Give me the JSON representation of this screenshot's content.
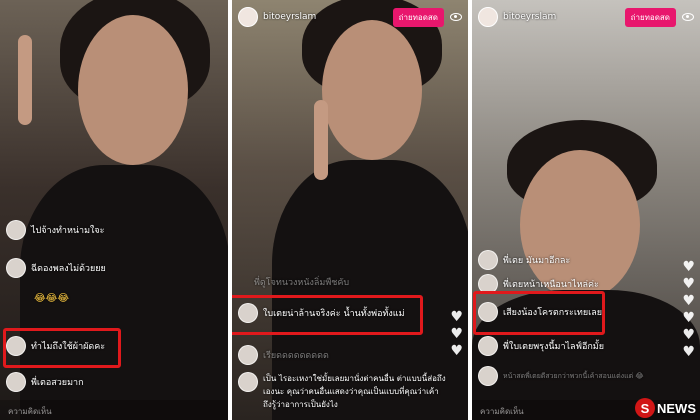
{
  "panels": [
    {
      "username": "",
      "comments": [
        {
          "text": "ไปจ้างทำหน่ามใจะ",
          "dim": false
        },
        {
          "text": "ฉีดองพลงไม่ด้วยยย",
          "dim": false
        },
        {
          "text": "😂😂😂",
          "dim": false
        },
        {
          "text": "ทำไมถึงใช้ผ้าผัดคะ",
          "dim": false,
          "highlighted": true
        },
        {
          "text": "พี่เตอสวยมาก",
          "dim": false
        }
      ],
      "comment_placeholder": "ความคิดเห็น"
    },
    {
      "username": "bitoeyrslam",
      "live_label": "ถ่ายทอดสด",
      "comments": [
        {
          "text": "พี่ดูโจทนวงหนังลิ่มพืชคับ",
          "dim": true
        },
        {
          "text": "ใบเตยน่าล้านจริงค่ะ น้ำนทั้งพ่อทั้งแม่",
          "dim": false,
          "highlighted": true
        },
        {
          "text": "เรียดดดดดดดดด",
          "dim": true
        },
        {
          "text": "เป็น ไรอะเหงาใช่มั้ยเลยมานั่งต่าคนอื่น ต่าแบบนี้ส่อถึง",
          "dim": false
        },
        {
          "text": "เองนะ คุณว่าคนอื่นแสดงว่าคุณเป็นแบบที่คุณว่าเค้า",
          "dim": false
        },
        {
          "text": "ถึงรู้ว่าอาการเป็นยังไง",
          "dim": false
        }
      ]
    },
    {
      "username": "bitoeyrslam",
      "live_label": "ถ่ายทอดสด",
      "comments": [
        {
          "text": "พี่เตย มันมาอีกละ",
          "dim": false
        },
        {
          "text": "พี่เตยหน้าเหนือนาไหล่ค่ะ",
          "dim": false
        },
        {
          "text": "เสียงน้องโครตกระเทยเลย",
          "dim": false,
          "highlighted": true
        },
        {
          "text": "พี่ใบเตยพรุงนี้มาไลฟ์อีกมั้ย",
          "dim": false
        },
        {
          "text": "หน้าสดพี่เตยดีสวยกว่าพวกนี้เค้าสอนแต่งแต่ 😂",
          "dim": true
        }
      ],
      "comment_placeholder": "ความคิดเห็น"
    }
  ],
  "logo": {
    "mark": "S",
    "text": "NEWS"
  },
  "colors": {
    "highlight": "#e0191c",
    "live": "#e8176d"
  }
}
